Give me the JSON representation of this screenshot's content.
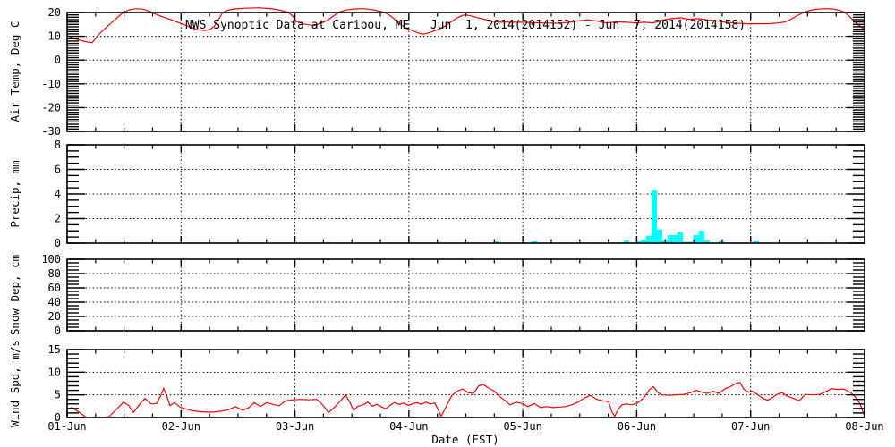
{
  "title": "NWS Synoptic Data at Caribou, ME   Jun  1, 2014(2014152) - Jun  7, 2014(2014158)",
  "x_axis": {
    "label": "Date (EST)",
    "tick_labels": [
      "01-Jun",
      "02-Jun",
      "03-Jun",
      "04-Jun",
      "05-Jun",
      "06-Jun",
      "07-Jun",
      "08-Jun"
    ],
    "days": 7,
    "minor_ticks_per_day": 4,
    "grid": "dotted-vertical-at-each-day"
  },
  "colors": {
    "line": "#ff0000",
    "precip_bar": "#00ffff",
    "axis": "#000000",
    "background": "#ffffff"
  },
  "chart_data": [
    {
      "panel": "air-temp",
      "type": "line",
      "ylabel": "Air Temp, Deg C",
      "ylim": [
        -30,
        20
      ],
      "ytick_values": [
        20,
        10,
        0,
        -10,
        -20,
        -30
      ],
      "ytick_labels": [
        "20",
        "10",
        "0",
        "-10",
        "-20",
        "-30"
      ],
      "grid_values": [
        10,
        0,
        -10,
        -20
      ],
      "minor_step": 1,
      "points": [
        [
          0.0,
          10.3
        ],
        [
          0.079,
          8.8
        ],
        [
          0.157,
          7.8
        ],
        [
          0.22,
          7.3
        ],
        [
          0.275,
          10.6
        ],
        [
          0.338,
          13.5
        ],
        [
          0.409,
          16.5
        ],
        [
          0.456,
          18.5
        ],
        [
          0.495,
          20.2
        ],
        [
          0.55,
          21.2
        ],
        [
          0.605,
          21.6
        ],
        [
          0.668,
          21.4
        ],
        [
          0.731,
          20.4
        ],
        [
          0.762,
          19.6
        ],
        [
          0.825,
          18.4
        ],
        [
          0.888,
          17.4
        ],
        [
          0.951,
          16.2
        ],
        [
          1.013,
          15.2
        ],
        [
          1.076,
          13.9
        ],
        [
          1.147,
          12.8
        ],
        [
          1.202,
          12.4
        ],
        [
          1.257,
          12.9
        ],
        [
          1.296,
          14.5
        ],
        [
          1.328,
          17.0
        ],
        [
          1.359,
          19.5
        ],
        [
          1.398,
          20.8
        ],
        [
          1.469,
          21.5
        ],
        [
          1.571,
          21.8
        ],
        [
          1.689,
          22.0
        ],
        [
          1.807,
          21.5
        ],
        [
          1.885,
          20.8
        ],
        [
          1.94,
          20.1
        ],
        [
          1.98,
          18.5
        ],
        [
          2.011,
          16.3
        ],
        [
          2.066,
          15.3
        ],
        [
          2.121,
          14.8
        ],
        [
          2.176,
          14.6
        ],
        [
          2.223,
          15.5
        ],
        [
          2.278,
          16.5
        ],
        [
          2.333,
          18.3
        ],
        [
          2.38,
          20.0
        ],
        [
          2.443,
          21.0
        ],
        [
          2.522,
          21.5
        ],
        [
          2.6,
          21.6
        ],
        [
          2.679,
          21.2
        ],
        [
          2.75,
          20.5
        ],
        [
          2.789,
          20.0
        ],
        [
          2.828,
          18.9
        ],
        [
          2.875,
          17.2
        ],
        [
          2.922,
          15.3
        ],
        [
          2.969,
          13.5
        ],
        [
          3.008,
          12.8
        ],
        [
          3.055,
          11.9
        ],
        [
          3.095,
          11.2
        ],
        [
          3.134,
          10.9
        ],
        [
          3.189,
          11.7
        ],
        [
          3.252,
          12.8
        ],
        [
          3.315,
          14.2
        ],
        [
          3.378,
          16.3
        ],
        [
          3.425,
          17.8
        ],
        [
          3.472,
          18.8
        ],
        [
          3.503,
          19.0
        ],
        [
          3.558,
          18.4
        ],
        [
          3.621,
          17.6
        ],
        [
          3.676,
          17.0
        ],
        [
          3.731,
          16.3
        ],
        [
          3.794,
          16.0
        ],
        [
          3.888,
          15.9
        ],
        [
          3.998,
          15.9
        ],
        [
          4.1,
          15.7
        ],
        [
          4.202,
          15.6
        ],
        [
          4.297,
          15.5
        ],
        [
          4.391,
          15.8
        ],
        [
          4.493,
          16.5
        ],
        [
          4.572,
          16.9
        ],
        [
          4.65,
          16.4
        ],
        [
          4.729,
          15.6
        ],
        [
          4.831,
          16.1
        ],
        [
          4.91,
          15.9
        ],
        [
          4.988,
          15.6
        ],
        [
          5.067,
          15.9
        ],
        [
          5.146,
          15.6
        ],
        [
          5.224,
          16.8
        ],
        [
          5.303,
          17.4
        ],
        [
          5.381,
          17.8
        ],
        [
          5.46,
          17.1
        ],
        [
          5.539,
          17.4
        ],
        [
          5.617,
          16.9
        ],
        [
          5.696,
          16.5
        ],
        [
          5.774,
          15.9
        ],
        [
          5.853,
          15.6
        ],
        [
          5.947,
          15.3
        ],
        [
          6.049,
          15.3
        ],
        [
          6.151,
          15.3
        ],
        [
          6.246,
          15.6
        ],
        [
          6.301,
          16.0
        ],
        [
          6.348,
          17.0
        ],
        [
          6.395,
          18.3
        ],
        [
          6.434,
          19.3
        ],
        [
          6.465,
          20.0
        ],
        [
          6.512,
          20.8
        ],
        [
          6.567,
          21.3
        ],
        [
          6.646,
          21.6
        ],
        [
          6.724,
          21.5
        ],
        [
          6.787,
          20.8
        ],
        [
          6.826,
          20.0
        ],
        [
          6.866,
          18.4
        ],
        [
          6.905,
          16.5
        ],
        [
          6.952,
          14.6
        ],
        [
          7.0,
          12.9
        ]
      ]
    },
    {
      "panel": "precip",
      "type": "bar",
      "ylabel": "Precip, mm",
      "ylim": [
        0,
        8
      ],
      "ytick_values": [
        8,
        6,
        4,
        2,
        0
      ],
      "ytick_labels": [
        "8",
        "6",
        "4",
        "2",
        "0"
      ],
      "grid_values": [
        6,
        4,
        2
      ],
      "minor_step": 0.5,
      "bar_width_days": 0.047,
      "bars": [
        [
          3.747,
          0.15
        ],
        [
          4.077,
          0.15
        ],
        [
          4.886,
          0.2
        ],
        [
          4.988,
          0.15
        ],
        [
          5.036,
          0.3
        ],
        [
          5.083,
          0.6
        ],
        [
          5.13,
          4.3
        ],
        [
          5.177,
          1.1
        ],
        [
          5.224,
          0.25
        ],
        [
          5.271,
          0.65
        ],
        [
          5.318,
          0.65
        ],
        [
          5.358,
          0.9
        ],
        [
          5.405,
          0.1
        ],
        [
          5.452,
          0.1
        ],
        [
          5.499,
          0.65
        ],
        [
          5.546,
          1.0
        ],
        [
          5.593,
          0.2
        ],
        [
          5.719,
          0.17
        ],
        [
          6.025,
          0.17
        ]
      ]
    },
    {
      "panel": "snow-depth",
      "type": "line",
      "ylabel": "Snow Dep, cm",
      "ylim": [
        0,
        100
      ],
      "ytick_values": [
        100,
        80,
        60,
        40,
        20,
        0
      ],
      "ytick_labels": [
        "100",
        "80",
        "60",
        "40",
        "20",
        "0"
      ],
      "grid_values": [
        80,
        60,
        40,
        20
      ],
      "minor_step": 5,
      "points": [
        [
          0.0,
          0
        ],
        [
          7.0,
          0
        ]
      ]
    },
    {
      "panel": "wind-speed",
      "type": "line",
      "ylabel": "Wind Spd, m/s",
      "ylim": [
        0,
        15
      ],
      "ytick_values": [
        15,
        10,
        5,
        0
      ],
      "ytick_labels": [
        "15",
        "10",
        "5",
        "0"
      ],
      "grid_values": [
        10,
        5
      ],
      "minor_step": 1,
      "points": [
        [
          0.0,
          1.8
        ],
        [
          0.039,
          2.2
        ],
        [
          0.079,
          1.6
        ],
        [
          0.126,
          0.8
        ],
        [
          0.165,
          0.1
        ],
        [
          0.236,
          0.0
        ],
        [
          0.314,
          0.0
        ],
        [
          0.369,
          0.2
        ],
        [
          0.432,
          1.8
        ],
        [
          0.495,
          3.4
        ],
        [
          0.542,
          2.6
        ],
        [
          0.581,
          1.1
        ],
        [
          0.636,
          2.9
        ],
        [
          0.683,
          4.2
        ],
        [
          0.738,
          3.0
        ],
        [
          0.786,
          3.1
        ],
        [
          0.825,
          5.0
        ],
        [
          0.848,
          6.5
        ],
        [
          0.88,
          4.4
        ],
        [
          0.903,
          2.6
        ],
        [
          0.943,
          3.3
        ],
        [
          0.99,
          2.3
        ],
        [
          1.045,
          1.9
        ],
        [
          1.1,
          1.5
        ],
        [
          1.163,
          1.3
        ],
        [
          1.225,
          1.2
        ],
        [
          1.288,
          1.2
        ],
        [
          1.351,
          1.4
        ],
        [
          1.414,
          1.7
        ],
        [
          1.477,
          2.4
        ],
        [
          1.54,
          1.6
        ],
        [
          1.595,
          2.2
        ],
        [
          1.642,
          3.3
        ],
        [
          1.697,
          2.4
        ],
        [
          1.752,
          3.3
        ],
        [
          1.807,
          2.9
        ],
        [
          1.862,
          2.6
        ],
        [
          1.917,
          3.7
        ],
        [
          1.98,
          3.9
        ],
        [
          2.05,
          4.0
        ],
        [
          2.121,
          3.9
        ],
        [
          2.192,
          4.0
        ],
        [
          2.247,
          2.7
        ],
        [
          2.294,
          1.1
        ],
        [
          2.349,
          2.3
        ],
        [
          2.404,
          3.8
        ],
        [
          2.443,
          5.0
        ],
        [
          2.482,
          3.4
        ],
        [
          2.514,
          1.6
        ],
        [
          2.553,
          2.5
        ],
        [
          2.6,
          2.8
        ],
        [
          2.639,
          3.4
        ],
        [
          2.679,
          2.5
        ],
        [
          2.718,
          2.9
        ],
        [
          2.757,
          2.4
        ],
        [
          2.797,
          1.9
        ],
        [
          2.836,
          2.7
        ],
        [
          2.875,
          3.3
        ],
        [
          2.914,
          2.9
        ],
        [
          2.954,
          3.2
        ],
        [
          2.993,
          2.7
        ],
        [
          3.032,
          3.0
        ],
        [
          3.071,
          3.3
        ],
        [
          3.11,
          2.9
        ],
        [
          3.15,
          3.4
        ],
        [
          3.189,
          3.0
        ],
        [
          3.228,
          3.2
        ],
        [
          3.26,
          1.5
        ],
        [
          3.283,
          0.3
        ],
        [
          3.315,
          1.8
        ],
        [
          3.338,
          3.0
        ],
        [
          3.378,
          4.9
        ],
        [
          3.425,
          5.8
        ],
        [
          3.472,
          6.3
        ],
        [
          3.519,
          5.5
        ],
        [
          3.566,
          5.3
        ],
        [
          3.613,
          7.0
        ],
        [
          3.653,
          7.3
        ],
        [
          3.7,
          6.5
        ],
        [
          3.747,
          5.9
        ],
        [
          3.794,
          4.7
        ],
        [
          3.841,
          3.8
        ],
        [
          3.888,
          2.8
        ],
        [
          3.943,
          3.4
        ],
        [
          3.998,
          3.1
        ],
        [
          4.045,
          2.4
        ],
        [
          4.1,
          3.1
        ],
        [
          4.155,
          2.2
        ],
        [
          4.21,
          2.4
        ],
        [
          4.265,
          2.2
        ],
        [
          4.32,
          2.3
        ],
        [
          4.375,
          2.4
        ],
        [
          4.43,
          2.8
        ],
        [
          4.485,
          3.4
        ],
        [
          4.54,
          4.3
        ],
        [
          4.595,
          4.9
        ],
        [
          4.65,
          4.0
        ],
        [
          4.705,
          3.7
        ],
        [
          4.752,
          3.5
        ],
        [
          4.783,
          1.2
        ],
        [
          4.807,
          0.3
        ],
        [
          4.838,
          1.8
        ],
        [
          4.87,
          2.8
        ],
        [
          4.909,
          3.0
        ],
        [
          4.948,
          2.8
        ],
        [
          4.988,
          3.0
        ],
        [
          5.019,
          3.4
        ],
        [
          5.067,
          4.5
        ],
        [
          5.114,
          6.2
        ],
        [
          5.146,
          6.8
        ],
        [
          5.185,
          5.5
        ],
        [
          5.224,
          5.0
        ],
        [
          5.287,
          4.9
        ],
        [
          5.35,
          5.0
        ],
        [
          5.413,
          5.1
        ],
        [
          5.476,
          5.5
        ],
        [
          5.523,
          6.0
        ],
        [
          5.57,
          5.6
        ],
        [
          5.617,
          5.3
        ],
        [
          5.672,
          5.8
        ],
        [
          5.719,
          5.3
        ],
        [
          5.774,
          6.3
        ],
        [
          5.829,
          6.9
        ],
        [
          5.876,
          7.6
        ],
        [
          5.908,
          7.7
        ],
        [
          5.939,
          6.3
        ],
        [
          5.978,
          5.6
        ],
        [
          6.017,
          5.8
        ],
        [
          6.064,
          5.0
        ],
        [
          6.111,
          4.2
        ],
        [
          6.15,
          3.8
        ],
        [
          6.19,
          4.4
        ],
        [
          6.229,
          5.1
        ],
        [
          6.276,
          5.5
        ],
        [
          6.323,
          4.7
        ],
        [
          6.378,
          4.2
        ],
        [
          6.425,
          3.7
        ],
        [
          6.48,
          5.1
        ],
        [
          6.543,
          5.0
        ],
        [
          6.606,
          5.1
        ],
        [
          6.669,
          5.8
        ],
        [
          6.708,
          6.4
        ],
        [
          6.763,
          6.2
        ],
        [
          6.818,
          6.3
        ],
        [
          6.873,
          5.6
        ],
        [
          6.92,
          4.5
        ],
        [
          6.959,
          3.1
        ],
        [
          6.983,
          1.5
        ],
        [
          6.999,
          0.3
        ]
      ]
    }
  ]
}
